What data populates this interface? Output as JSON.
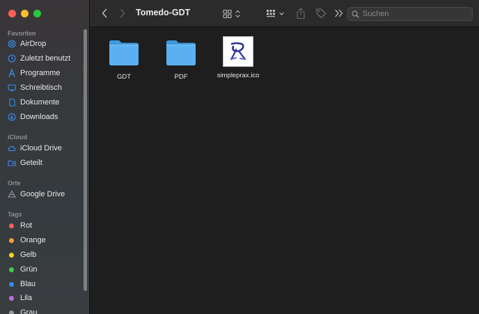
{
  "window": {
    "title": "Tomedo-GDT"
  },
  "search": {
    "placeholder": "Suchen"
  },
  "sidebar": {
    "favorites_title": "Favoriten",
    "favorites": [
      {
        "label": "AirDrop",
        "icon": "airdrop-icon"
      },
      {
        "label": "Zuletzt benutzt",
        "icon": "clock-icon"
      },
      {
        "label": "Programme",
        "icon": "apps-icon"
      },
      {
        "label": "Schreibtisch",
        "icon": "desktop-icon"
      },
      {
        "label": "Dokumente",
        "icon": "document-icon"
      },
      {
        "label": "Downloads",
        "icon": "download-icon"
      }
    ],
    "icloud_title": "iCloud",
    "icloud": [
      {
        "label": "iCloud Drive",
        "icon": "cloud-icon"
      },
      {
        "label": "Geteilt",
        "icon": "shared-folder-icon"
      }
    ],
    "locations_title": "Orte",
    "locations": [
      {
        "label": "Google Drive",
        "icon": "drive-icon"
      }
    ],
    "tags_title": "Tags",
    "tags": [
      {
        "label": "Rot",
        "color": "#ff5f57"
      },
      {
        "label": "Orange",
        "color": "#f7a032"
      },
      {
        "label": "Gelb",
        "color": "#f5d423"
      },
      {
        "label": "Grün",
        "color": "#3fcf4a"
      },
      {
        "label": "Blau",
        "color": "#2e8ef5"
      },
      {
        "label": "Lila",
        "color": "#c06be0"
      },
      {
        "label": "Grau",
        "color": "#9a9a9e"
      }
    ]
  },
  "files": [
    {
      "name": "GDT",
      "kind": "folder-icon"
    },
    {
      "name": "PDF",
      "kind": "folder-icon"
    },
    {
      "name": "simpleprax.ico",
      "kind": "ico-file-thumbnail"
    }
  ],
  "colors": {
    "accent": "#3b8ff5",
    "folder": "#5ab0f0"
  }
}
